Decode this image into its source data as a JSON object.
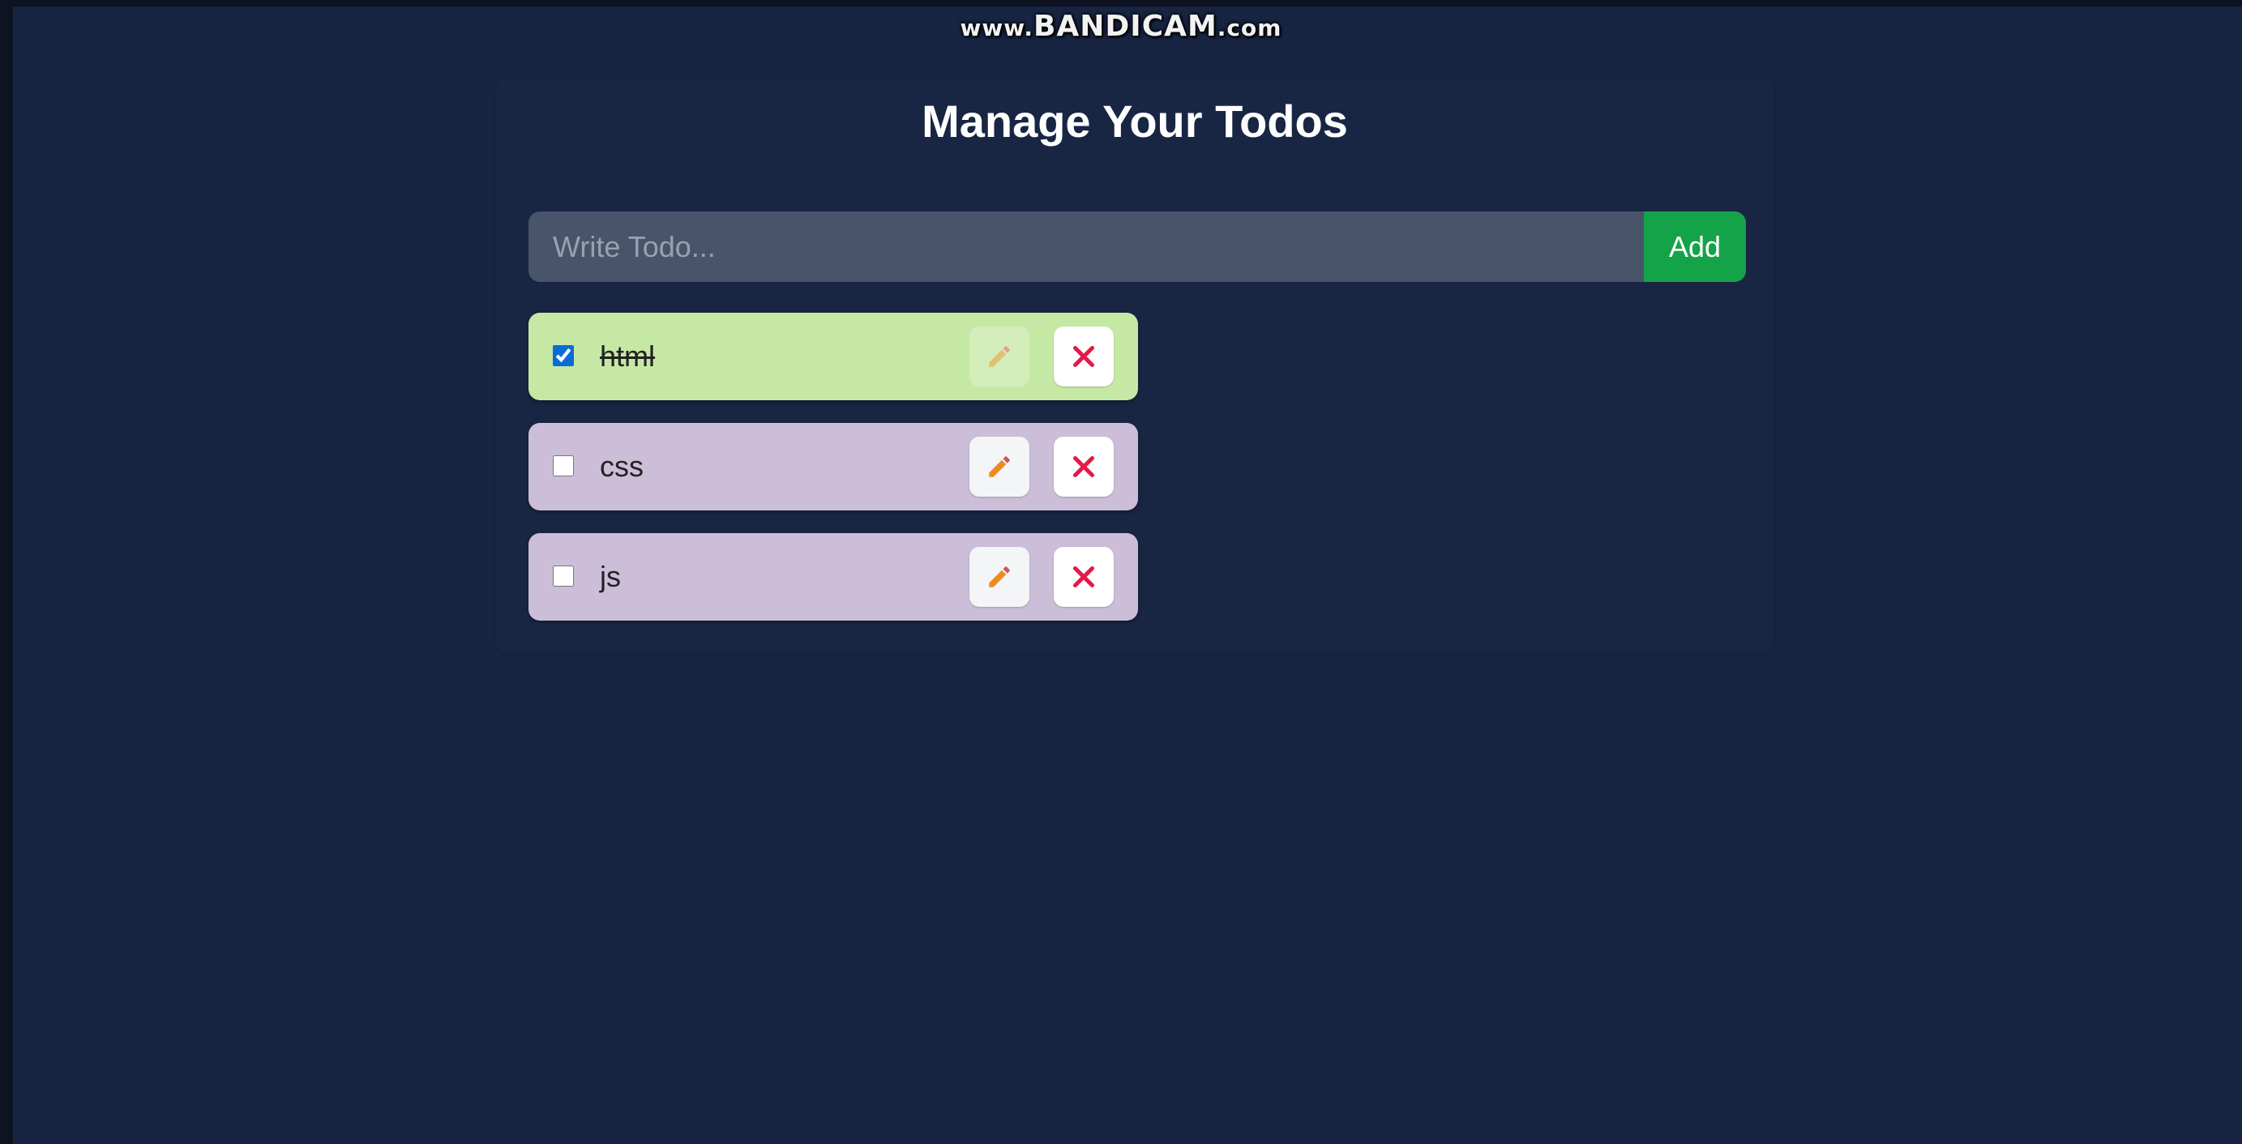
{
  "watermark": {
    "prefix": "www.",
    "brand": "BANDICAM",
    "suffix": ".com"
  },
  "header": {
    "title": "Manage Your Todos"
  },
  "form": {
    "placeholder": "Write Todo...",
    "value": "",
    "add_label": "Add"
  },
  "todos": [
    {
      "text": "html",
      "completed": true
    },
    {
      "text": "css",
      "completed": false
    },
    {
      "text": "js",
      "completed": false
    }
  ],
  "icons": {
    "edit": "pencil-icon",
    "delete": "close-icon"
  },
  "colors": {
    "page_background": "#172542",
    "input_background": "#47546a",
    "add_button": "#15a34a",
    "todo_pending": "#ccbed9",
    "todo_done": "#c6e8a5",
    "pencil": "#f08a1c",
    "delete_x": "#e5194a"
  }
}
